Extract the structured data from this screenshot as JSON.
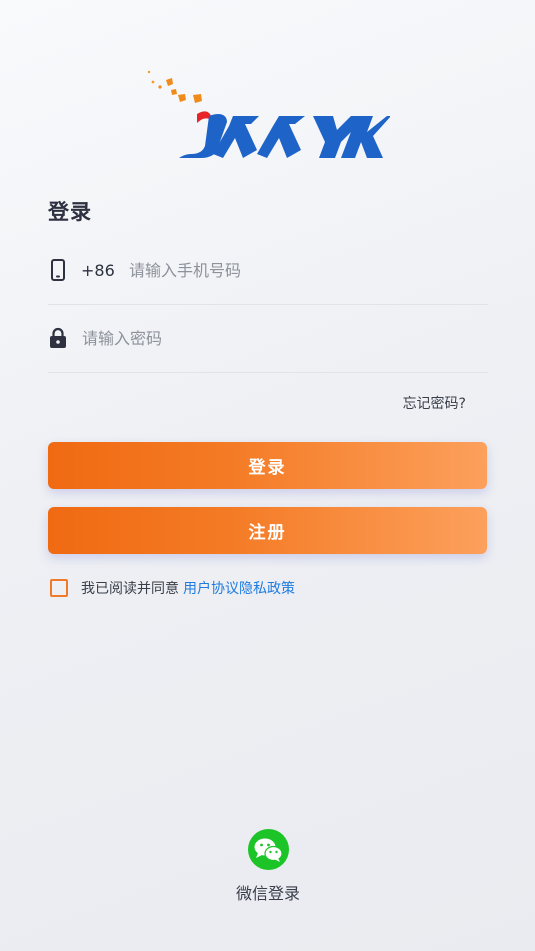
{
  "logo": {
    "text": "XXYK"
  },
  "page": {
    "title": "登录"
  },
  "phone": {
    "prefix": "+86",
    "placeholder": "请输入手机号码",
    "value": ""
  },
  "password": {
    "placeholder": "请输入密码",
    "value": ""
  },
  "links": {
    "forgot": "忘记密码?"
  },
  "buttons": {
    "login": "登录",
    "register": "注册"
  },
  "agreement": {
    "text": "我已阅读并同意",
    "link": "用户协议隐私政策",
    "checked": false
  },
  "wechat": {
    "label": "微信登录",
    "icon": "wechat-icon"
  },
  "colors": {
    "accent_start": "#f06a12",
    "accent_end": "#fca05c",
    "link": "#1f7be0",
    "wechat": "#1dc427"
  }
}
